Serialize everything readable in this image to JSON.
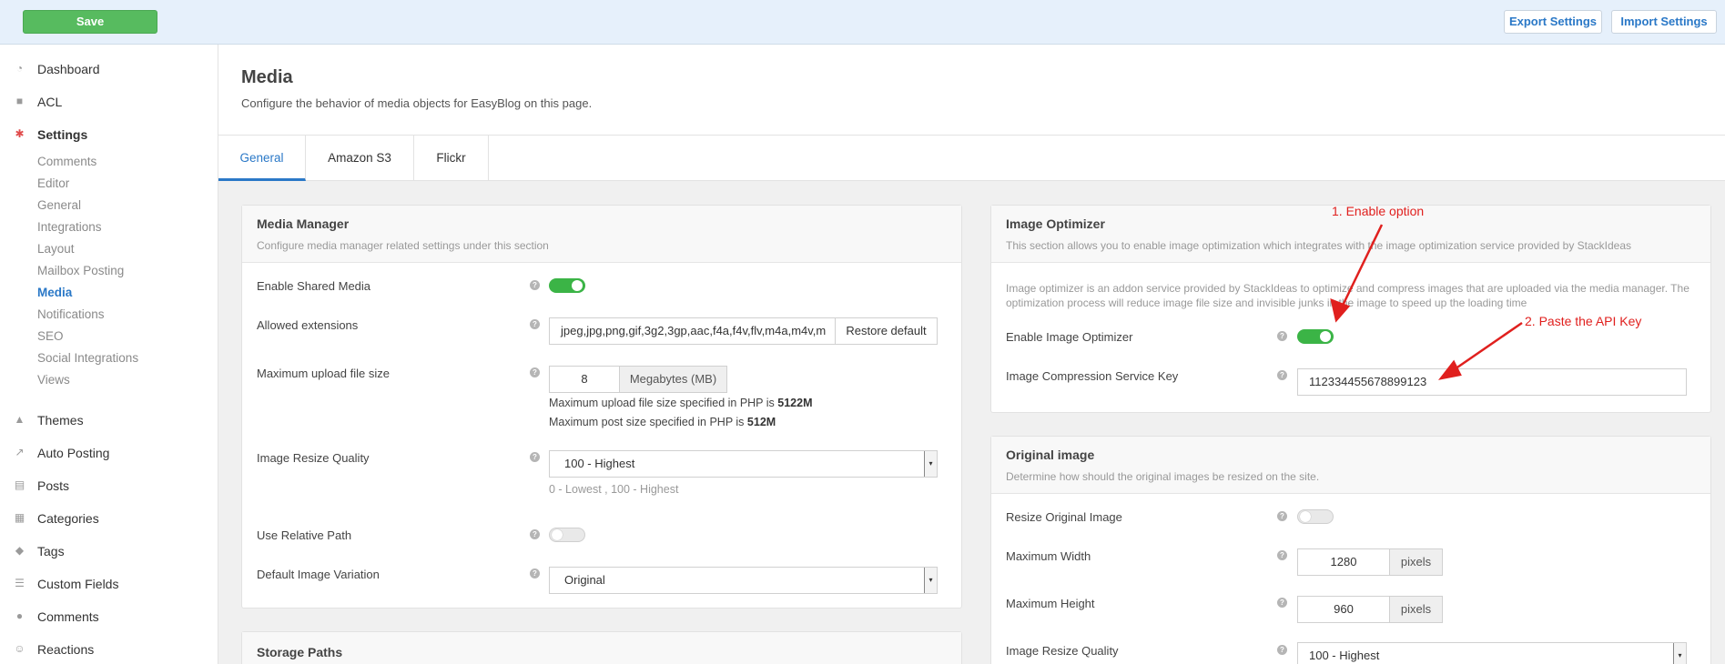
{
  "toolbar": {
    "save_label": "Save",
    "export_label": "Export Settings",
    "import_label": "Import Settings"
  },
  "sidebar": {
    "items": [
      {
        "label": "Dashboard",
        "icon": "dashboard-icon"
      },
      {
        "label": "ACL",
        "icon": "lock-icon"
      },
      {
        "label": "Settings",
        "icon": "gear-icon"
      }
    ],
    "settings_subitems": [
      "Comments",
      "Editor",
      "General",
      "Integrations",
      "Layout",
      "Mailbox Posting",
      "Media",
      "Notifications",
      "SEO",
      "Social Integrations",
      "Views"
    ],
    "active_subitem": "Media",
    "lower_items": [
      {
        "label": "Themes",
        "icon": "flask-icon"
      },
      {
        "label": "Auto Posting",
        "icon": "share-icon"
      },
      {
        "label": "Posts",
        "icon": "document-icon"
      },
      {
        "label": "Categories",
        "icon": "archive-icon"
      },
      {
        "label": "Tags",
        "icon": "tags-icon"
      },
      {
        "label": "Custom Fields",
        "icon": "list-icon"
      },
      {
        "label": "Comments",
        "icon": "comments-icon"
      },
      {
        "label": "Reactions",
        "icon": "smile-icon"
      }
    ]
  },
  "page": {
    "title": "Media",
    "description": "Configure the behavior of media objects for EasyBlog on this page."
  },
  "tabs": [
    "General",
    "Amazon S3",
    "Flickr"
  ],
  "active_tab": "General",
  "media_manager": {
    "title": "Media Manager",
    "description": "Configure media manager related settings under this section",
    "enable_shared_media": {
      "label": "Enable Shared Media",
      "enabled": true
    },
    "allowed_extensions": {
      "label": "Allowed extensions",
      "value": "jpeg,jpg,png,gif,3g2,3gp,aac,f4a,f4v,flv,m4a,m4v,m",
      "restore_label": "Restore default"
    },
    "max_upload": {
      "label": "Maximum upload file size",
      "value": "8",
      "unit": "Megabytes (MB)",
      "php_note_prefix": "Maximum upload file size specified in PHP is",
      "php_note_value": "5122M",
      "post_note_prefix": "Maximum post size specified in PHP is",
      "post_note_value": "512M"
    },
    "resize_quality": {
      "label": "Image Resize Quality",
      "value": "100 - Highest",
      "hint": "0 - Lowest , 100 - Highest"
    },
    "relative_path": {
      "label": "Use Relative Path",
      "enabled": false
    },
    "default_variation": {
      "label": "Default Image Variation",
      "value": "Original"
    }
  },
  "storage_paths": {
    "title": "Storage Paths"
  },
  "image_optimizer": {
    "title": "Image Optimizer",
    "description": "This section allows you to enable image optimization which integrates with the image optimization service provided by StackIdeas",
    "info_line1": "Image optimizer is an addon service provided by StackIdeas to optimize and compress images that are uploaded via the media manager. The",
    "info_line2": "optimization process will reduce image file size and invisible junks in the image to speed up the loading time",
    "enable": {
      "label": "Enable Image Optimizer",
      "enabled": true
    },
    "service_key": {
      "label": "Image Compression Service Key",
      "value": "112334455678899123"
    }
  },
  "original_image": {
    "title": "Original image",
    "description": "Determine how should the original images be resized on the site.",
    "resize": {
      "label": "Resize Original Image",
      "enabled": false
    },
    "max_width": {
      "label": "Maximum Width",
      "value": "1280",
      "unit": "pixels"
    },
    "max_height": {
      "label": "Maximum Height",
      "value": "960",
      "unit": "pixels"
    },
    "resize_quality": {
      "label": "Image Resize Quality",
      "value": "100 - Highest"
    }
  },
  "annotations": {
    "step1": "1. Enable option",
    "step2": "2. Paste the API Key",
    "color": "#e0201e"
  },
  "colors": {
    "accent": "#2a78c7",
    "save_green": "#57bb5f",
    "toggle_on": "#3bb446"
  }
}
